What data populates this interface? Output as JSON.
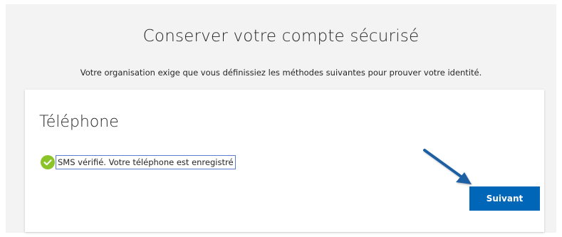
{
  "header": {
    "title": "Conserver votre compte sécurisé",
    "subtitle": "Votre organisation exige que vous définissiez les méthodes suivantes pour prouver votre identité."
  },
  "card": {
    "title": "Téléphone",
    "status": {
      "icon": "check-circle-icon",
      "text": "SMS vérifié. Votre téléphone est enregistré"
    },
    "next_button_label": "Suivant"
  },
  "annotation": {
    "icon": "arrow-icon",
    "color": "#1f5fa3"
  },
  "colors": {
    "accent": "#0067b8",
    "success": "#8ac428",
    "background": "#f3f3f3",
    "card": "#ffffff"
  }
}
